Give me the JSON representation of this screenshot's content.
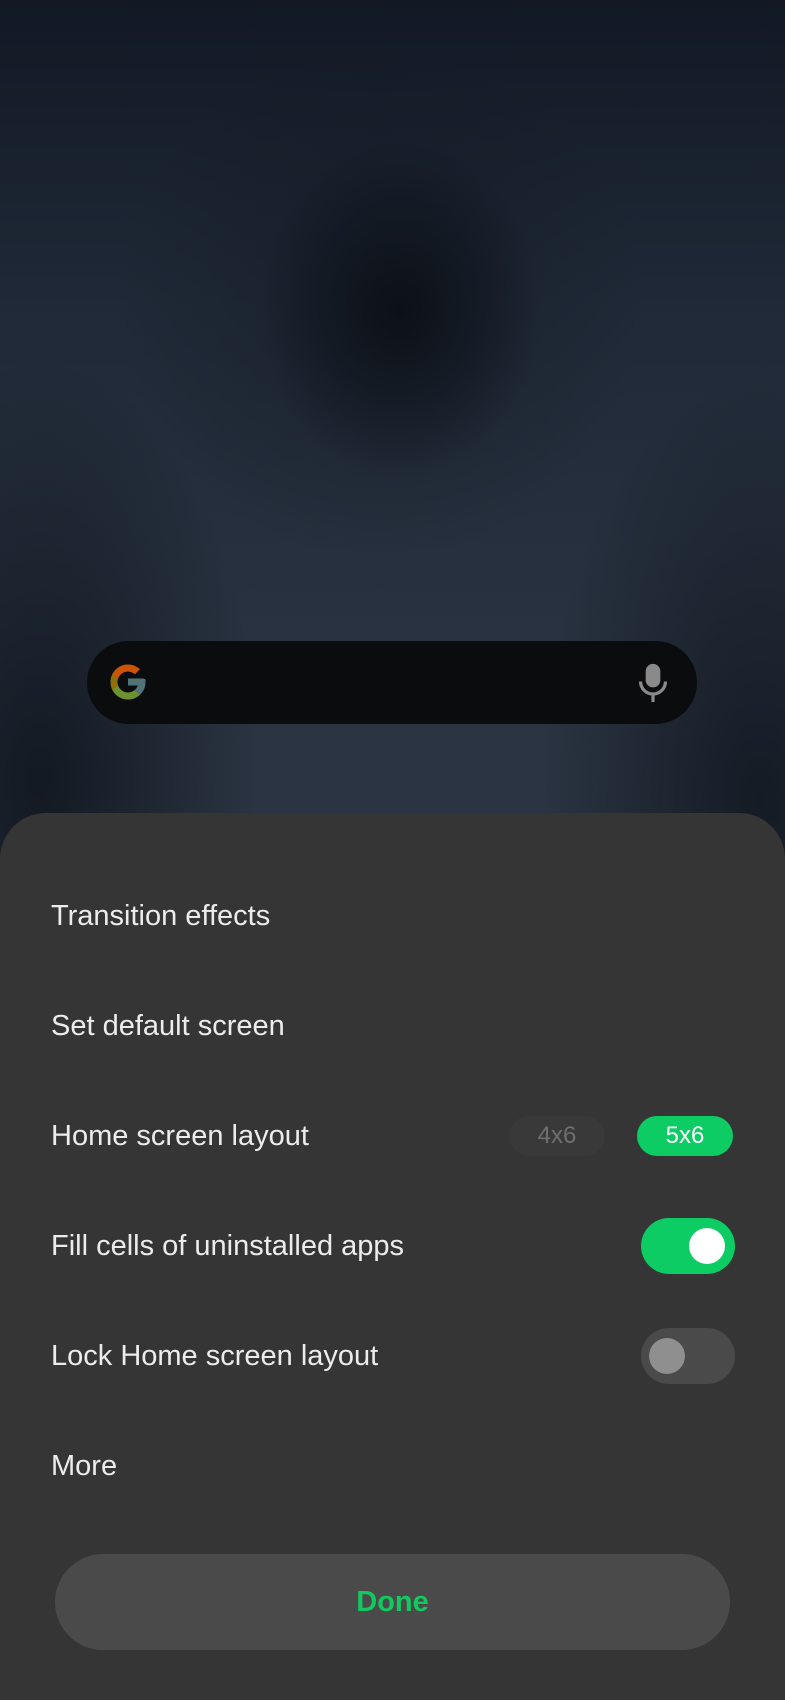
{
  "search_widget": {
    "logo_icon": "google-g-icon",
    "mic_icon": "microphone-icon"
  },
  "settings": {
    "items": [
      {
        "label": "Transition effects"
      },
      {
        "label": "Set default screen"
      },
      {
        "label": "Home screen layout",
        "options": [
          "4x6",
          "5x6"
        ],
        "selected": "5x6"
      },
      {
        "label": "Fill cells of uninstalled apps",
        "toggle": true
      },
      {
        "label": "Lock Home screen layout",
        "toggle": false
      },
      {
        "label": "More"
      }
    ],
    "done_label": "Done"
  },
  "colors": {
    "accent": "#0dcc63",
    "sheet_background": "#353535",
    "button_background": "#4a4a4a"
  }
}
